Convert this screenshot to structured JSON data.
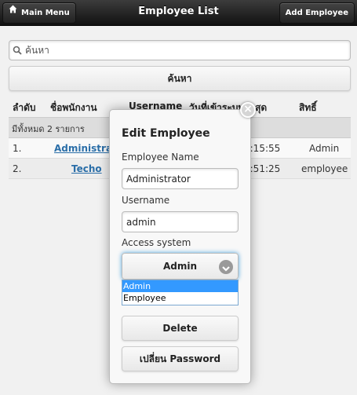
{
  "header": {
    "title": "Employee List",
    "main_menu_label": "Main Menu",
    "add_employee_label": "Add Employee"
  },
  "search": {
    "placeholder": "ค้นหา",
    "button_label": "ค้นหา"
  },
  "table": {
    "columns": [
      "ลำดับ",
      "ชื่อพนักงาน",
      "Username",
      "วันที่เข้าระบบล่าสุด",
      "สิทธิ์"
    ],
    "summary": "มีทั้งหมด 2 รายการ",
    "rows": [
      {
        "no": "1.",
        "name": "Administrator",
        "last_login": "0:15:55",
        "role": "Admin"
      },
      {
        "no": "2.",
        "name": "Techo",
        "last_login": "5:51:25",
        "role": "employee"
      }
    ]
  },
  "popup": {
    "title": "Edit Employee",
    "employee_name_label": "Employee Name",
    "employee_name_value": "Administrator",
    "username_label": "Username",
    "username_value": "admin",
    "access_label": "Access system",
    "access_selected": "Admin",
    "access_options": [
      "Admin",
      "Employee"
    ],
    "delete_label": "Delete",
    "change_password_label": "เปลี่ยน Password"
  },
  "colors": {
    "link": "#2a6ea8",
    "selected_option": "#3399ff",
    "header_bg": "#1e1e1e"
  },
  "icons": {
    "home": "home-icon",
    "search": "search-icon",
    "close": "close-icon",
    "chevron": "chevron-down-icon"
  }
}
